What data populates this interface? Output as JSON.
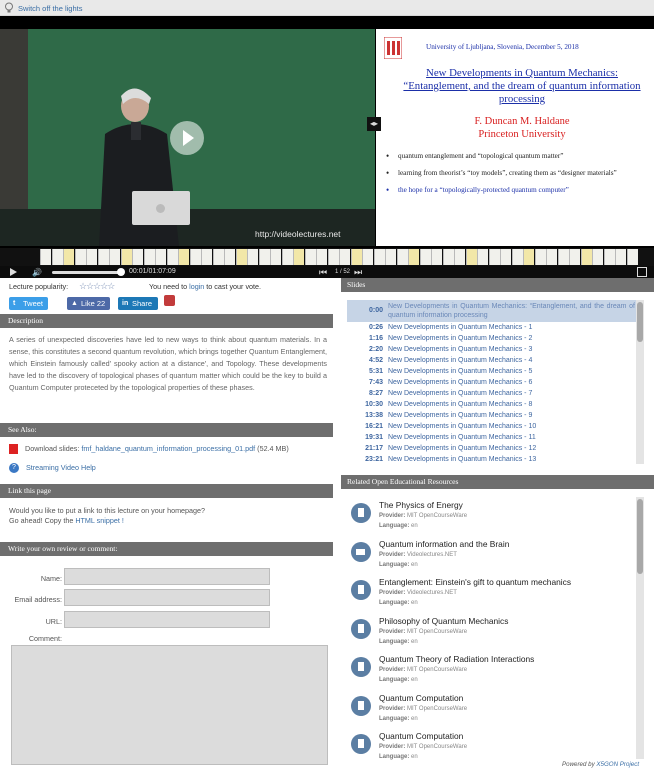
{
  "topbar": {
    "lights_label": "Switch off the lights"
  },
  "player": {
    "watermark": "http://videolectures.net",
    "slide": {
      "university": "University of  Ljubljana, Slovenia, December 5, 2018",
      "title": "New Developments in Quantum Mechanics: “Entanglement, and the dream of  quantum information processing",
      "author_name": "F. Duncan M. Haldane",
      "author_affil": "Princeton University",
      "bullets": [
        "quantum entanglement and “topological quantum matter”",
        "learning from theorist’s  “toy models”,  creating them  as “designer materials”",
        "the hope for a “topologically-protected quantum computer”"
      ]
    },
    "controls": {
      "time": "00:01/01:07:09",
      "slide_counter": "1 / 52"
    }
  },
  "rating": {
    "popularity_label": "Lecture popularity:",
    "vote_prefix": "You need to",
    "vote_link": "login",
    "vote_suffix": "to cast your vote."
  },
  "social": {
    "tweet": "Tweet",
    "like": "Like 22",
    "share": "Share"
  },
  "description": {
    "header": "Description",
    "text": "A series of unexpected discoveries have led to new ways to think about quantum materials. In a sense, this constitutes a second quantum revolution, which brings together Quantum Entanglement, which Einstein famously called' spooky action at a distance', and Topology. These developments have led to the discovery of topological phases of quantum matter which could be the key to build a Quantum Computer proteceted by the topological properties of these phases."
  },
  "see_also": {
    "header": "See Also:",
    "download_prefix": "Download slides:",
    "download_link": "fmf_haldane_quantum_information_processing_01.pdf",
    "download_size": "(52.4 MB)",
    "streaming_help": "Streaming Video Help"
  },
  "link_page": {
    "header": "Link this page",
    "line1": "Would you like to put a link to this lecture on your homepage?",
    "line2_prefix": "Go ahead! Copy the",
    "line2_link": "HTML snippet !"
  },
  "review": {
    "header": "Write your own review or comment:",
    "name_label": "Name:",
    "email_label": "Email address:",
    "url_label": "URL:",
    "comment_label": "Comment:"
  },
  "slides": {
    "header": "Slides",
    "items": [
      {
        "time": "0:00",
        "title": "New Developments in Quantum Mechanics: “Entanglement, and the dream of quantum information processing"
      },
      {
        "time": "0:26",
        "title": "New Developments in Quantum Mechanics - 1"
      },
      {
        "time": "1:16",
        "title": "New Developments in Quantum Mechanics - 2"
      },
      {
        "time": "2:20",
        "title": "New Developments in Quantum Mechanics - 3"
      },
      {
        "time": "4:52",
        "title": "New Developments in Quantum Mechanics - 4"
      },
      {
        "time": "5:31",
        "title": "New Developments in Quantum Mechanics - 5"
      },
      {
        "time": "7:43",
        "title": "New Developments in Quantum Mechanics - 6"
      },
      {
        "time": "8:27",
        "title": "New Developments in Quantum Mechanics - 7"
      },
      {
        "time": "10:30",
        "title": "New Developments in Quantum Mechanics - 8"
      },
      {
        "time": "13:38",
        "title": "New Developments in Quantum Mechanics - 9"
      },
      {
        "time": "16:21",
        "title": "New Developments in Quantum Mechanics - 10"
      },
      {
        "time": "19:31",
        "title": "New Developments in Quantum Mechanics - 11"
      },
      {
        "time": "21:17",
        "title": "New Developments in Quantum Mechanics - 12"
      },
      {
        "time": "23:21",
        "title": "New Developments in Quantum Mechanics - 13"
      }
    ]
  },
  "oer": {
    "header": "Related Open Educational Resources",
    "provider_label": "Provider:",
    "language_label": "Language:",
    "items": [
      {
        "title": "The Physics of Energy",
        "provider": "MIT OpenCourseWare",
        "language": "en",
        "icon": "document-icon"
      },
      {
        "title": "Quantum information and the Brain",
        "provider": "Videolectures.NET",
        "language": "en",
        "icon": "video-icon"
      },
      {
        "title": "Entanglement: Einstein's gift to quantum mechanics",
        "provider": "Videolectures.NET",
        "language": "en",
        "icon": "document-icon"
      },
      {
        "title": "Philosophy of Quantum Mechanics",
        "provider": "MIT OpenCourseWare",
        "language": "en",
        "icon": "document-icon"
      },
      {
        "title": "Quantum Theory of Radiation Interactions",
        "provider": "MIT OpenCourseWare",
        "language": "en",
        "icon": "document-icon"
      },
      {
        "title": "Quantum Computation",
        "provider": "MIT OpenCourseWare",
        "language": "en",
        "icon": "document-icon"
      },
      {
        "title": "Quantum Computation",
        "provider": "MIT OpenCourseWare",
        "language": "en",
        "icon": "document-icon"
      }
    ],
    "powered_prefix": "Powered by",
    "powered_link": "X5GON Project"
  },
  "colors": {
    "link": "#3a6ea5",
    "section_bar": "#6e6e6e",
    "slide_highlight": "#c6d4e6"
  }
}
